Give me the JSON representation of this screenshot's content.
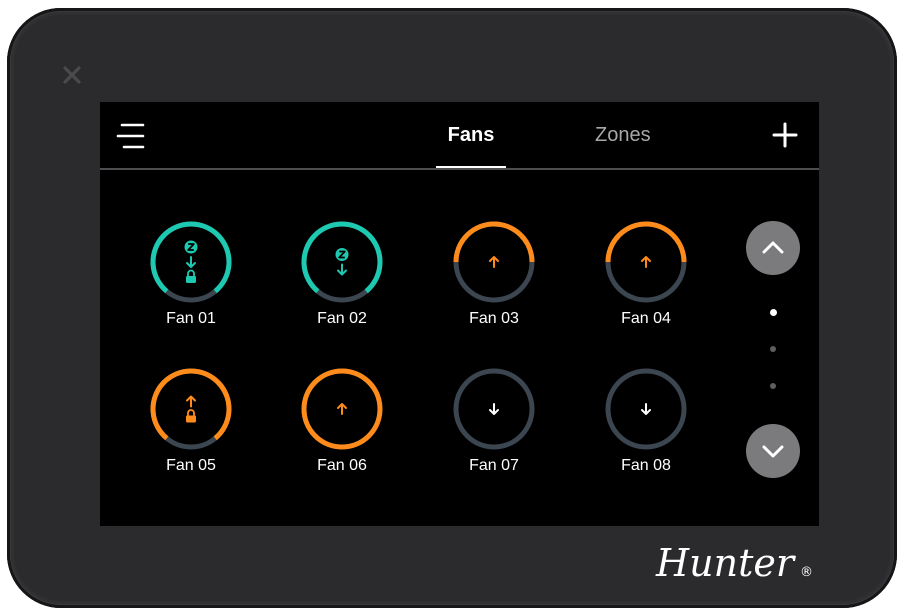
{
  "header": {
    "tabs": [
      {
        "label": "Fans",
        "active": true
      },
      {
        "label": "Zones",
        "active": false
      }
    ]
  },
  "colors": {
    "sleep_teal": "#1ec9b1",
    "active_orange": "#ff8c1a",
    "inactive_ring": "#3b4650",
    "arrow_white": "#ffffff"
  },
  "fans": [
    {
      "label": "Fan 01",
      "state": "sleep",
      "direction": "down",
      "locked": true,
      "level": 0.78
    },
    {
      "label": "Fan 02",
      "state": "sleep",
      "direction": "down",
      "locked": false,
      "level": 0.78
    },
    {
      "label": "Fan 03",
      "state": "on",
      "direction": "up",
      "locked": false,
      "level": 0.5
    },
    {
      "label": "Fan 04",
      "state": "on",
      "direction": "up",
      "locked": false,
      "level": 0.5
    },
    {
      "label": "Fan 05",
      "state": "on",
      "direction": "up",
      "locked": true,
      "level": 0.78
    },
    {
      "label": "Fan 06",
      "state": "on",
      "direction": "up",
      "locked": false,
      "level": 1.0
    },
    {
      "label": "Fan 07",
      "state": "off",
      "direction": "down",
      "locked": false,
      "level": 0
    },
    {
      "label": "Fan 08",
      "state": "off",
      "direction": "down",
      "locked": false,
      "level": 0
    }
  ],
  "pagination": {
    "pages": 3,
    "current": 1
  },
  "icons": {
    "menu": "menu-icon",
    "add": "plus-icon",
    "close": "close-icon",
    "scroll_up": "chevron-up-icon",
    "scroll_down": "chevron-down-icon",
    "sleep": "sleep-z-icon",
    "lock": "lock-icon"
  },
  "brand": {
    "name": "Hunter"
  }
}
